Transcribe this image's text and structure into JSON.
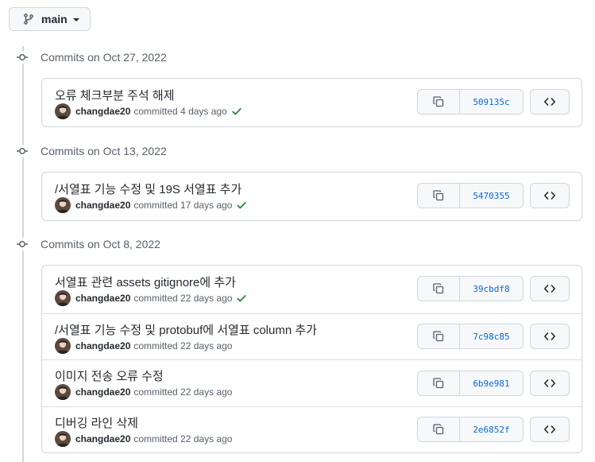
{
  "branch": {
    "name": "main",
    "icon": "git-branch-icon"
  },
  "groups": [
    {
      "title": "Commits on Oct 27, 2022",
      "commits": [
        {
          "message": "오류 체크부분 주석 해제",
          "author": "changdae20",
          "action": "committed 4 days ago",
          "verified": true,
          "sha": "509135c"
        }
      ]
    },
    {
      "title": "Commits on Oct 13, 2022",
      "commits": [
        {
          "message": "/서열표 기능 수정 및 19S 서열표 추가",
          "author": "changdae20",
          "action": "committed 17 days ago",
          "verified": true,
          "sha": "5470355"
        }
      ]
    },
    {
      "title": "Commits on Oct 8, 2022",
      "commits": [
        {
          "message": "서열표 관련 assets gitignore에 추가",
          "author": "changdae20",
          "action": "committed 22 days ago",
          "verified": true,
          "sha": "39cbdf8"
        },
        {
          "message": "/서열표 기능 수정 및 protobuf에 서열표 column 추가",
          "author": "changdae20",
          "action": "committed 22 days ago",
          "verified": false,
          "sha": "7c98c85"
        },
        {
          "message": "이미지 전송 오류 수정",
          "author": "changdae20",
          "action": "committed 22 days ago",
          "verified": false,
          "sha": "6b9e981"
        },
        {
          "message": "디버깅 라인 삭제",
          "author": "changdae20",
          "action": "committed 22 days ago",
          "verified": false,
          "sha": "2e6852f"
        }
      ]
    }
  ],
  "colors": {
    "link": "#0969da",
    "success": "#1a7f37",
    "border": "#d0d7de",
    "muted": "#57606a"
  }
}
